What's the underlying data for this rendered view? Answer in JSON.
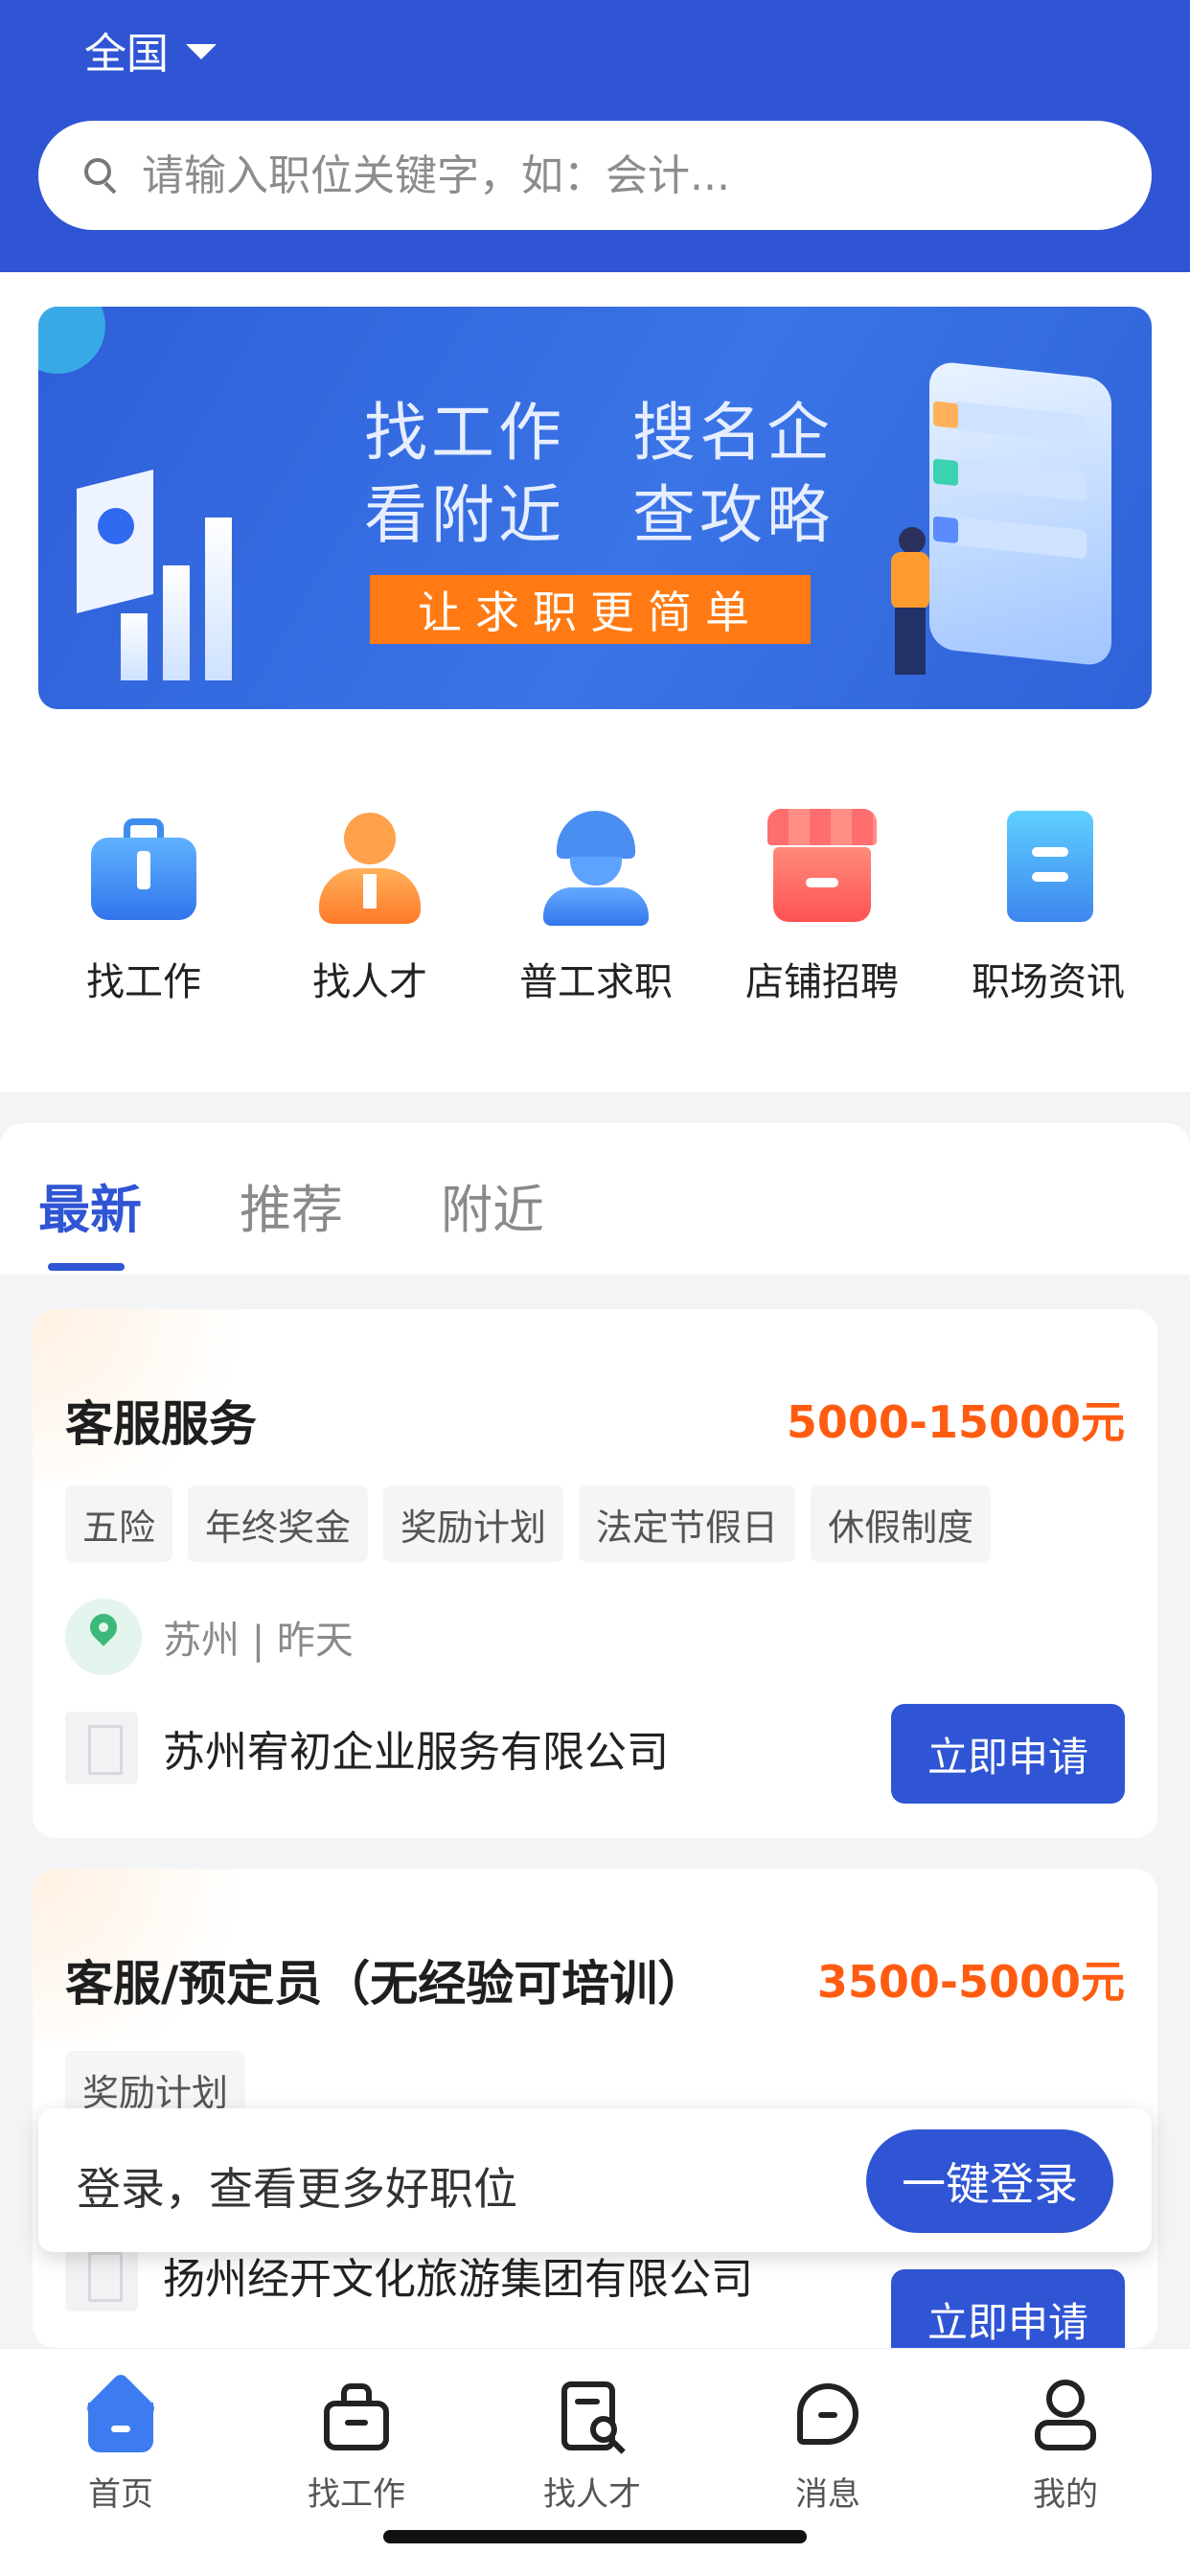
{
  "header": {
    "region_label": "全国",
    "search_placeholder": "请输入职位关键字，如：会计..."
  },
  "banner": {
    "line1": "找工作　搜名企",
    "line2": "看附近　查攻略",
    "cta": "让求职更简单"
  },
  "quick_actions": [
    {
      "label": "找工作",
      "icon": "briefcase-icon"
    },
    {
      "label": "找人才",
      "icon": "person-icon"
    },
    {
      "label": "普工求职",
      "icon": "worker-icon"
    },
    {
      "label": "店铺招聘",
      "icon": "store-icon"
    },
    {
      "label": "职场资讯",
      "icon": "news-icon"
    }
  ],
  "tabs": [
    "最新",
    "推荐",
    "附近"
  ],
  "jobs": [
    {
      "title": "客服服务",
      "salary": "5000-15000元",
      "tags": [
        "五险",
        "年终奖金",
        "奖励计划",
        "法定节假日",
        "休假制度"
      ],
      "location": "苏州 | 昨天",
      "company": "苏州宥初企业服务有限公司",
      "apply": "立即申请"
    },
    {
      "title": "客服/预定员（无经验可培训）",
      "salary": "3500-5000元",
      "tags": [
        "奖励计划"
      ],
      "company": "扬州经开文化旅游集团有限公司",
      "apply": "立即申请"
    }
  ],
  "login_prompt": {
    "text": "登录，查看更多好职位",
    "button": "一键登录"
  },
  "bottom_nav": [
    {
      "label": "首页",
      "icon": "home-icon"
    },
    {
      "label": "找工作",
      "icon": "bag-icon"
    },
    {
      "label": "找人才",
      "icon": "resume-search-icon"
    },
    {
      "label": "消息",
      "icon": "message-icon"
    },
    {
      "label": "我的",
      "icon": "profile-icon"
    }
  ],
  "colors": {
    "brand_blue": "#2f55d4",
    "salary_orange": "#ff5c12",
    "cta_orange": "#ff7a12"
  }
}
